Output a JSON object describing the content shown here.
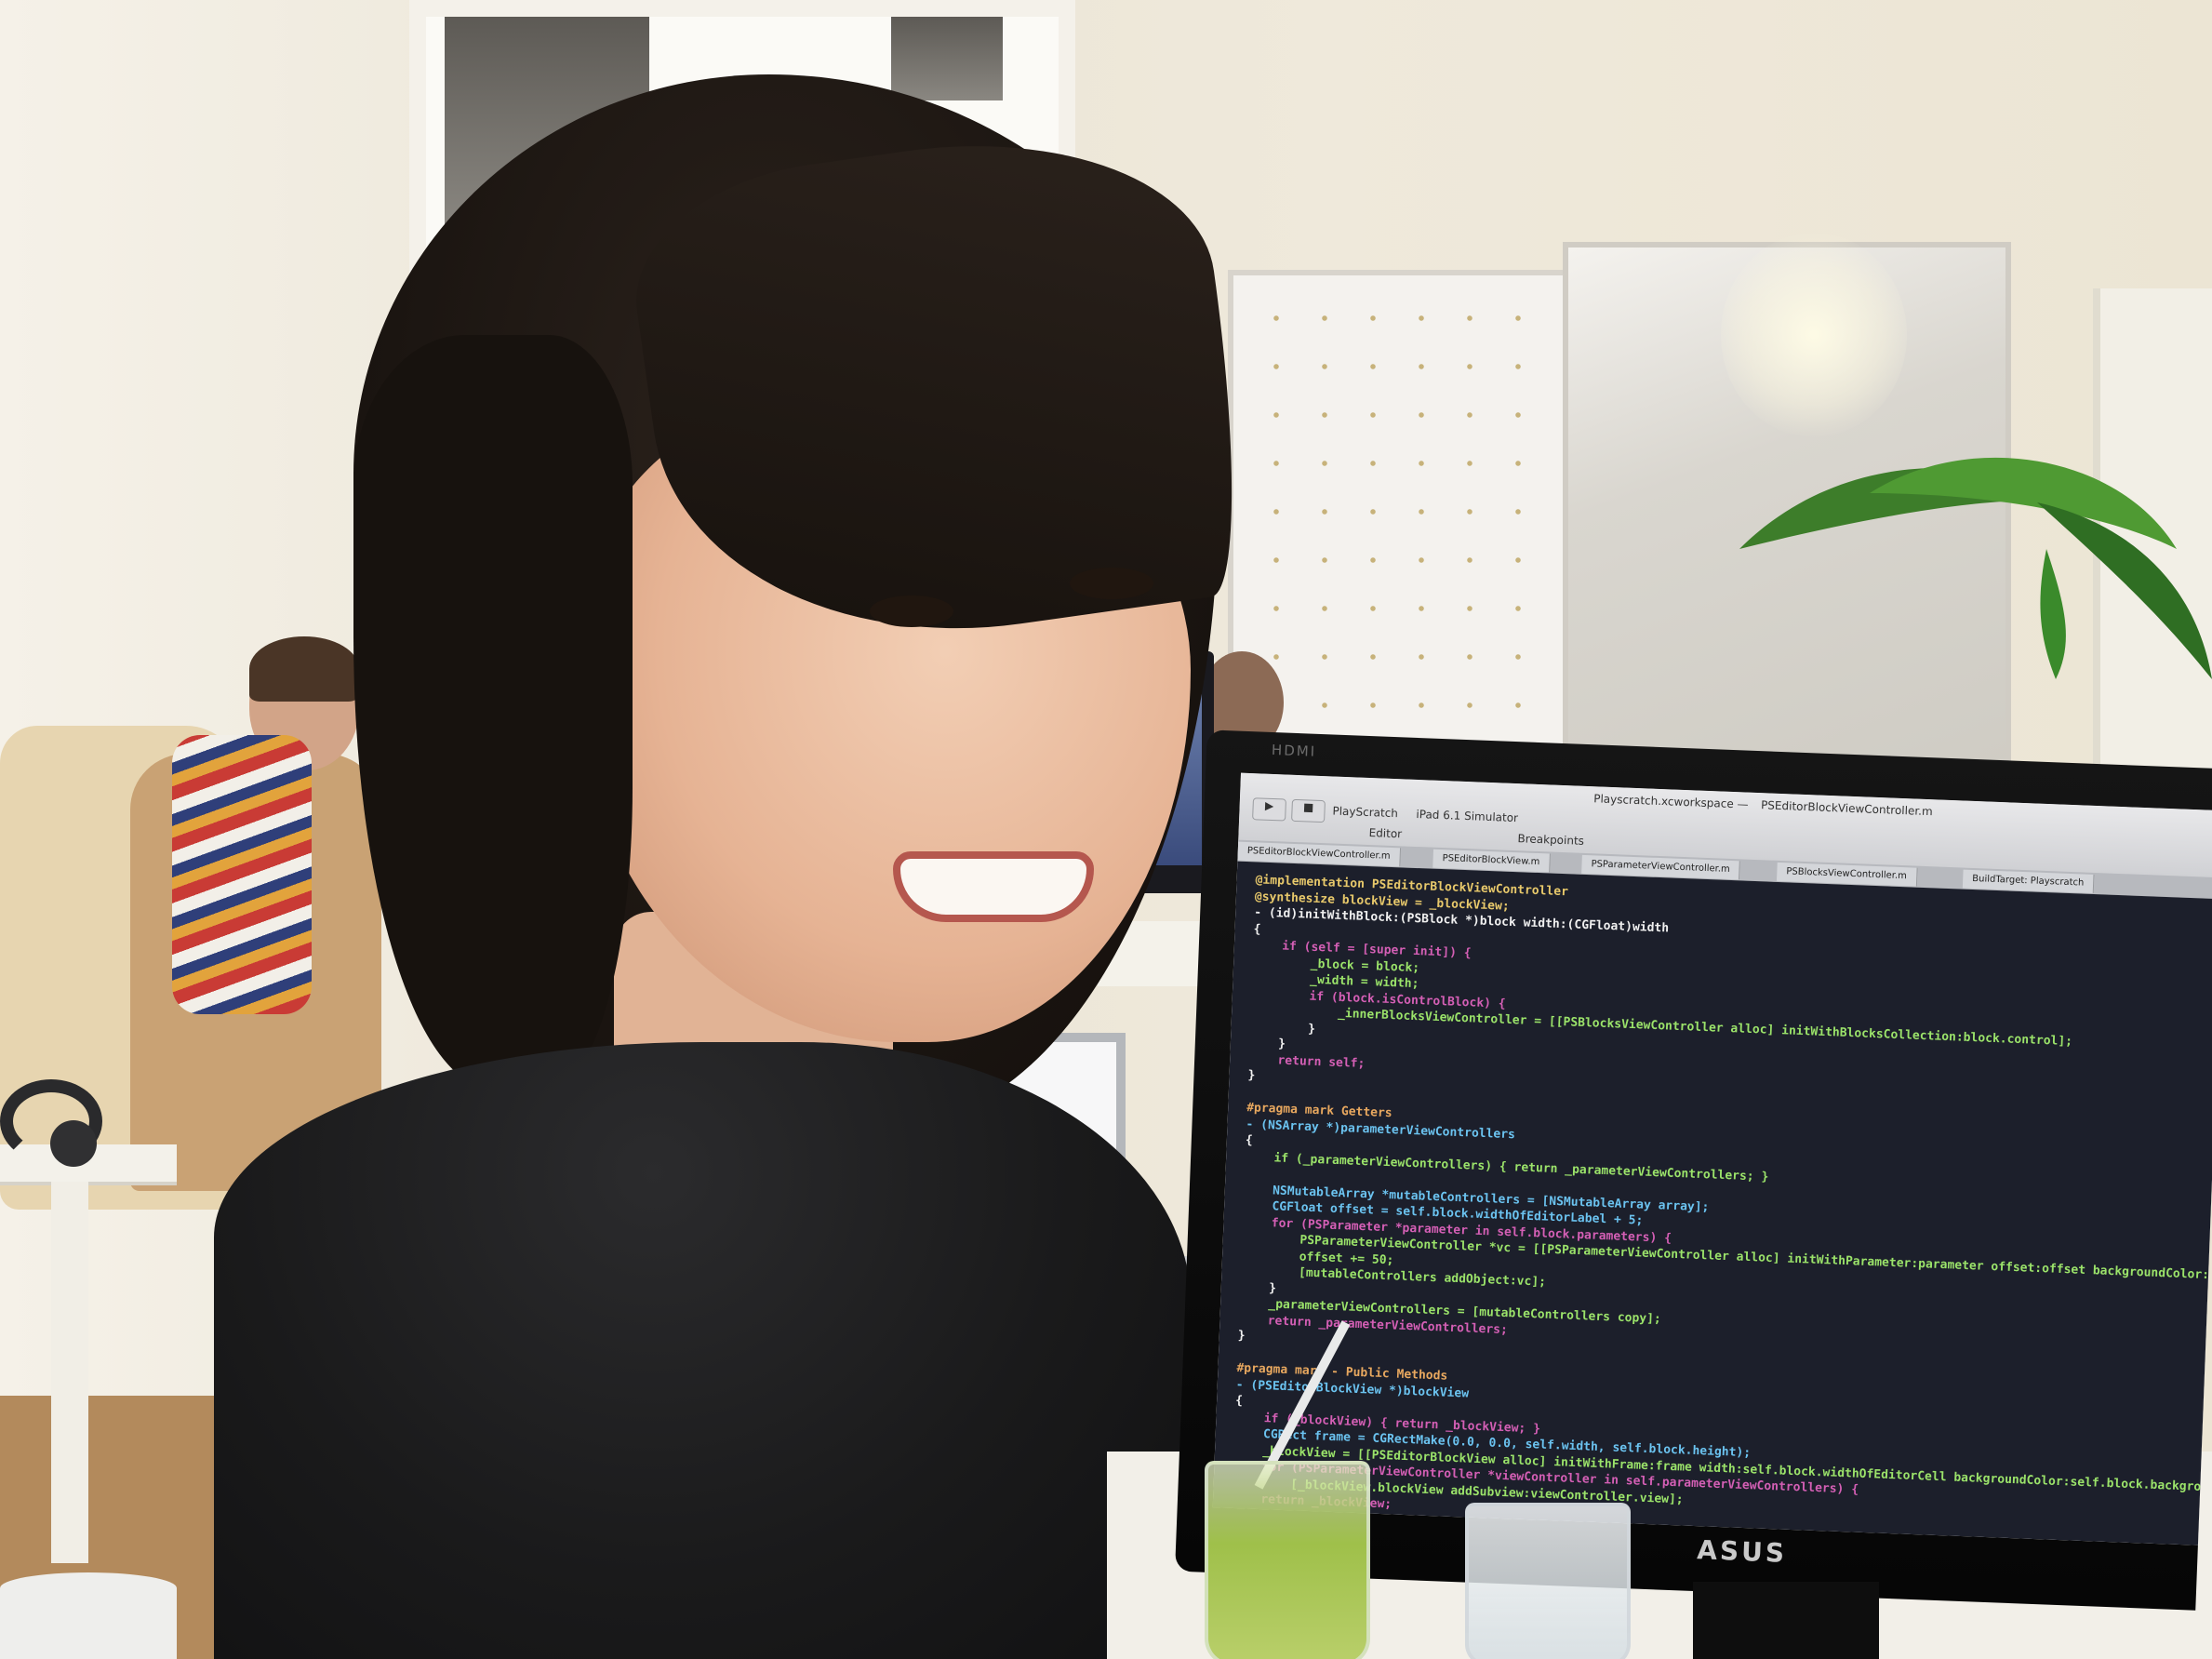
{
  "scene": {
    "description_tags": [
      "office",
      "person",
      "computer-monitor",
      "code-editor"
    ]
  },
  "monitor": {
    "brand": "ASUS",
    "brand_top": "HDMI"
  },
  "code_editor": {
    "window_title": "Playscratch.xcworkspace — ",
    "window_file": "PSEditorBlockViewController.m",
    "toolbar": {
      "run_label": "▶",
      "stop_label": "■",
      "scheme_label": "PlayScratch",
      "device_label": "iPad 6.1 Simulator",
      "editor_label": "Editor",
      "breakpoints_label": "Breakpoints"
    },
    "tabs": [
      "PSEditorBlockViewController.m",
      "PSEditorBlockView.m",
      "PSParameterViewController.m",
      "PSBlocksViewController.m",
      "BuildTarget: Playscratch"
    ],
    "lines": [
      {
        "text": "@implementation PSEditorBlockViewController",
        "color": "#e8c96b"
      },
      {
        "text": "@synthesize blockView = _blockView;",
        "color": "#e8c96b"
      },
      {
        "text": "- (id)initWithBlock:(PSBlock *)block width:(CGFloat)width",
        "color": "#f0f0f0"
      },
      {
        "text": "{",
        "color": "#f0f0f0"
      },
      {
        "text": "    if (self = [super init]) {",
        "color": "#d45fb5"
      },
      {
        "text": "        _block = block;",
        "color": "#9be36a"
      },
      {
        "text": "        _width = width;",
        "color": "#9be36a"
      },
      {
        "text": "        if (block.isControlBlock) {",
        "color": "#d45fb5"
      },
      {
        "text": "            _innerBlocksViewController = [[PSBlocksViewController alloc] initWithBlocksCollection:block.control];",
        "color": "#9be36a"
      },
      {
        "text": "        }",
        "color": "#f0f0f0"
      },
      {
        "text": "    }",
        "color": "#f0f0f0"
      },
      {
        "text": "    return self;",
        "color": "#d45fb5"
      },
      {
        "text": "}",
        "color": "#f0f0f0"
      },
      {
        "text": "",
        "color": "#f0f0f0"
      },
      {
        "text": "#pragma mark Getters",
        "color": "#e8a85f"
      },
      {
        "text": "- (NSArray *)parameterViewControllers",
        "color": "#6bc3f0"
      },
      {
        "text": "{",
        "color": "#f0f0f0"
      },
      {
        "text": "    if (_parameterViewControllers) { return _parameterViewControllers; }",
        "color": "#9be36a"
      },
      {
        "text": "",
        "color": "#f0f0f0"
      },
      {
        "text": "    NSMutableArray *mutableControllers = [NSMutableArray array];",
        "color": "#6bc3f0"
      },
      {
        "text": "    CGFloat offset = self.block.widthOfEditorLabel + 5;",
        "color": "#6bc3f0"
      },
      {
        "text": "    for (PSParameter *parameter in self.block.parameters) {",
        "color": "#d45fb5"
      },
      {
        "text": "        PSParameterViewController *vc = [[PSParameterViewController alloc] initWithParameter:parameter offset:offset backgroundColor:self.block.background",
        "color": "#9be36a"
      },
      {
        "text": "        offset += 50;",
        "color": "#9be36a"
      },
      {
        "text": "        [mutableControllers addObject:vc];",
        "color": "#9be36a"
      },
      {
        "text": "    }",
        "color": "#f0f0f0"
      },
      {
        "text": "    _parameterViewControllers = [mutableControllers copy];",
        "color": "#9be36a"
      },
      {
        "text": "    return _parameterViewControllers;",
        "color": "#d45fb5"
      },
      {
        "text": "}",
        "color": "#f0f0f0"
      },
      {
        "text": "",
        "color": "#f0f0f0"
      },
      {
        "text": "#pragma mark - Public Methods",
        "color": "#e8a85f"
      },
      {
        "text": "- (PSEditorBlockView *)blockView",
        "color": "#6bc3f0"
      },
      {
        "text": "{",
        "color": "#f0f0f0"
      },
      {
        "text": "    if (_blockView) { return _blockView; }",
        "color": "#d45fb5"
      },
      {
        "text": "    CGRect frame = CGRectMake(0.0, 0.0, self.width, self.block.height);",
        "color": "#6bc3f0"
      },
      {
        "text": "    _blockView = [[PSEditorBlockView alloc] initWithFrame:frame width:self.block.widthOfEditorCell backgroundColor:self.block.backgroundColor borderColor:self.bl",
        "color": "#9be36a"
      },
      {
        "text": "    for (PSParameterViewController *viewController in self.parameterViewControllers) {",
        "color": "#d45fb5"
      },
      {
        "text": "        [_blockView.blockView addSubview:viewController.view];",
        "color": "#9be36a"
      },
      {
        "text": "    return _blockView;",
        "color": "#d45fb5"
      }
    ]
  }
}
